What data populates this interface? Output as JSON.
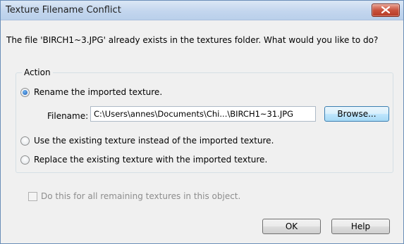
{
  "dialog": {
    "title": "Texture Filename Conflict",
    "message": "The file 'BIRCH1~3.JPG' already exists in the textures folder.  What would you like to do?"
  },
  "action_group": {
    "label": "Action",
    "options": [
      {
        "label": "Rename the imported texture.",
        "selected": true
      },
      {
        "label": "Use the existing texture instead of the imported texture.",
        "selected": false
      },
      {
        "label": "Replace the existing texture with the imported texture.",
        "selected": false
      }
    ],
    "filename_label": "Filename:",
    "filename_value": "C:\\Users\\annes\\Documents\\Chi...\\BIRCH1~31.JPG",
    "browse_label": "Browse..."
  },
  "checkbox": {
    "label": "Do this for all remaining textures in this object.",
    "checked": false,
    "enabled": false
  },
  "buttons": {
    "ok": "OK",
    "help": "Help"
  },
  "colors": {
    "titlebar": "#c3d6ee",
    "close_button": "#c9523d",
    "background": "#f0f0f0",
    "default_button_border": "#3c7fb1"
  },
  "icons": {
    "close": "close-icon"
  }
}
